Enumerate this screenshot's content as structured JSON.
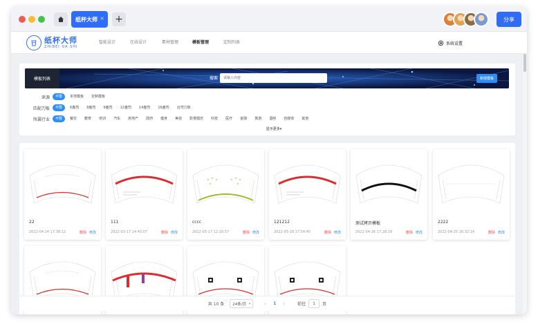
{
  "titlebar": {
    "active_tab": "纸杯大师",
    "tab_close": "×",
    "plus": "+",
    "share_label": "分享",
    "avatar_colors": [
      "#d9823a",
      "#e0a253",
      "#8a6a4a",
      "#7a9ad6"
    ]
  },
  "nav": {
    "logo_cn": "纸杯大师",
    "logo_en": "ZHIBEI DA SHI",
    "items": [
      "智能设计",
      "在线设计",
      "素材管理",
      "模板管理",
      "定制列表"
    ],
    "active_index": 3,
    "settings_label": "系统设置"
  },
  "filter": {
    "banner_title": "模板列表",
    "search_label": "搜索",
    "search_placeholder": "请输入内容",
    "add_button": "新增模板",
    "rows": [
      {
        "label": "来源",
        "chips": [
          "不限",
          "本地模板",
          "定制模板"
        ]
      },
      {
        "label": "匹配刀板",
        "chips": [
          "不限",
          "6盎司",
          "8盎司",
          "9盎司",
          "12盎司",
          "14盎司",
          "16盎司",
          "台湾刀板"
        ]
      },
      {
        "label": "所属行业",
        "chips": [
          "不限",
          "餐饮",
          "教育",
          "培训",
          "汽车",
          "房地产",
          "政府",
          "健身",
          "美容",
          "影楼婚庆",
          "科技",
          "医疗",
          "金融",
          "旅游",
          "酒吧",
          "自媒体",
          "其他"
        ]
      }
    ],
    "show_more": "显示更多▾"
  },
  "cards": [
    {
      "title": "22",
      "date": "2022-04-24 17:38:12",
      "delete": "删除",
      "edit": "修改",
      "style": "thin-red-low",
      "color": "#e02b2b"
    },
    {
      "title": "111",
      "date": "2022-03-17 14:43:07",
      "delete": "删除",
      "edit": "修改",
      "style": "thick-red",
      "color": "#e02b2b"
    },
    {
      "title": "cccc",
      "date": "2022-05-17 12:10:57",
      "delete": "删除",
      "edit": "修改",
      "style": "green-dots",
      "color": "#9bbd2a"
    },
    {
      "title": "121212",
      "date": "2022-05-18 17:54:45",
      "delete": "删除",
      "edit": "修改",
      "style": "thick-red",
      "color": "#e02b2b"
    },
    {
      "title": "测试拷贝模板",
      "date": "2022-04-26 17:28:19",
      "delete": "删除",
      "edit": "修改",
      "style": "thick-black",
      "color": "#111111"
    },
    {
      "title": "2222",
      "date": "2022-04-25 16:32:14",
      "delete": "删除",
      "edit": "修改",
      "style": "plain",
      "color": "#bbbbbb"
    },
    {
      "title": "",
      "date": "",
      "delete": "",
      "edit": "",
      "style": "thin-red-low",
      "color": "#e02b2b"
    },
    {
      "title": "",
      "date": "",
      "delete": "",
      "edit": "",
      "style": "red-ribbons",
      "color": "#e02b2b"
    },
    {
      "title": "",
      "date": "",
      "delete": "",
      "edit": "",
      "style": "qr-thin",
      "color": "#e02b2b"
    },
    {
      "title": "",
      "date": "",
      "delete": "",
      "edit": "",
      "style": "qr-thin",
      "color": "#e02b2b"
    }
  ],
  "pager": {
    "total": "共 10 条",
    "page_size": "24条/页",
    "prev": "‹",
    "current": "1",
    "next": "›",
    "goto": "前往",
    "jump_value": "1",
    "page_unit": "页"
  },
  "colors": {
    "accent": "#2f6df6",
    "link": "#2f8ef5",
    "danger": "#f24b4b"
  }
}
